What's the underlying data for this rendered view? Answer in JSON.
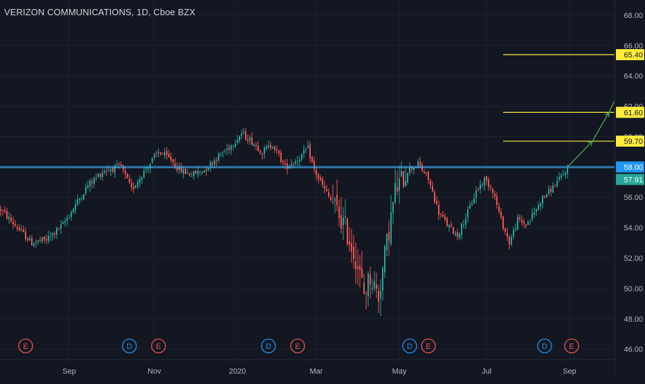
{
  "header": {
    "symbol_title": "VERIZON COMMUNICATIONS, 1D, Cboe BZX"
  },
  "colors": {
    "background": "#131722",
    "grid": "#1e2230",
    "axis_text": "#b2b5be",
    "up": "#26a69a",
    "down": "#ef5350",
    "target_line": "#ffeb3b",
    "support_line": "#2196f3",
    "arrow": "#4caf50",
    "dividend_event": "#2196f3",
    "earnings_event": "#ef5350"
  },
  "chart_data": {
    "type": "candlestick",
    "title": "VERIZON COMMUNICATIONS, 1D, Cboe BZX",
    "y_range": [
      45.3,
      69.0
    ],
    "y_ticks": [
      "46.00",
      "48.00",
      "50.00",
      "52.00",
      "54.00",
      "56.00",
      "58.00",
      "60.00",
      "62.00",
      "64.00",
      "66.00",
      "68.00"
    ],
    "x_labels": [
      "Sep",
      "Nov",
      "2020",
      "Mar",
      "May",
      "Jul",
      "Sep"
    ],
    "grid": true,
    "bars_shown": 260,
    "close_path": [
      [
        0,
        55.2
      ],
      [
        8,
        54.0
      ],
      [
        15,
        53.0
      ],
      [
        22,
        53.2
      ],
      [
        30,
        54.2
      ],
      [
        36,
        55.5
      ],
      [
        42,
        56.8
      ],
      [
        50,
        57.8
      ],
      [
        58,
        58.0
      ],
      [
        63,
        56.5
      ],
      [
        68,
        57.5
      ],
      [
        76,
        59.0
      ],
      [
        82,
        58.5
      ],
      [
        86,
        57.8
      ],
      [
        92,
        57.5
      ],
      [
        98,
        57.8
      ],
      [
        104,
        58.6
      ],
      [
        110,
        59.3
      ],
      [
        116,
        60.2
      ],
      [
        120,
        59.8
      ],
      [
        126,
        59.0
      ],
      [
        131,
        59.5
      ],
      [
        137,
        58.0
      ],
      [
        143,
        58.5
      ],
      [
        148,
        59.2
      ],
      [
        151,
        57.8
      ],
      [
        156,
        56.5
      ],
      [
        160,
        55.6
      ],
      [
        166,
        54.0
      ],
      [
        171,
        52.0
      ],
      [
        175,
        49.7
      ],
      [
        178,
        50.8
      ],
      [
        182,
        49.5
      ],
      [
        186,
        53.0
      ],
      [
        190,
        56.4
      ],
      [
        196,
        57.8
      ],
      [
        201,
        58.2
      ],
      [
        206,
        57.2
      ],
      [
        211,
        55.0
      ],
      [
        215,
        54.2
      ],
      [
        220,
        53.5
      ],
      [
        225,
        55.0
      ],
      [
        229,
        56.4
      ],
      [
        233,
        57.2
      ],
      [
        237,
        56.5
      ],
      [
        241,
        54.5
      ],
      [
        245,
        53.0
      ],
      [
        249,
        54.5
      ],
      [
        253,
        54.2
      ],
      [
        257,
        55.0
      ],
      [
        261,
        56.0
      ],
      [
        265,
        56.5
      ],
      [
        269,
        57.2
      ],
      [
        273,
        57.9
      ]
    ],
    "last_bar": 273,
    "price_labels": [
      {
        "value": 65.4,
        "text": "65.40",
        "type": "target"
      },
      {
        "value": 61.6,
        "text": "61.60",
        "type": "target"
      },
      {
        "value": 59.7,
        "text": "59.70",
        "type": "target"
      },
      {
        "value": 58.0,
        "text": "58.00",
        "type": "support"
      },
      {
        "value": 57.91,
        "text": "57.91",
        "type": "last-price"
      }
    ],
    "horizontal_lines": [
      {
        "value": 65.4,
        "from_bar": 300,
        "kind": "target"
      },
      {
        "value": 61.6,
        "from_bar": 300,
        "kind": "target"
      },
      {
        "value": 59.7,
        "from_bar": 300,
        "kind": "target"
      },
      {
        "value": 58.0,
        "from_bar": 0,
        "kind": "support"
      }
    ],
    "projection_path": [
      [
        273,
        58.0
      ],
      [
        285,
        59.7
      ],
      [
        293,
        61.6
      ],
      [
        306,
        65.4
      ]
    ],
    "events": [
      {
        "letter": "E",
        "kind": "earnings",
        "bar": 12
      },
      {
        "letter": "D",
        "kind": "dividend",
        "bar": 62
      },
      {
        "letter": "E",
        "kind": "earnings",
        "bar": 76
      },
      {
        "letter": "D",
        "kind": "dividend",
        "bar": 129
      },
      {
        "letter": "E",
        "kind": "earnings",
        "bar": 143
      },
      {
        "letter": "D",
        "kind": "dividend",
        "bar": 197
      },
      {
        "letter": "E",
        "kind": "earnings",
        "bar": 206
      },
      {
        "letter": "D",
        "kind": "dividend",
        "bar": 262
      },
      {
        "letter": "E",
        "kind": "earnings",
        "bar": 275
      }
    ]
  }
}
